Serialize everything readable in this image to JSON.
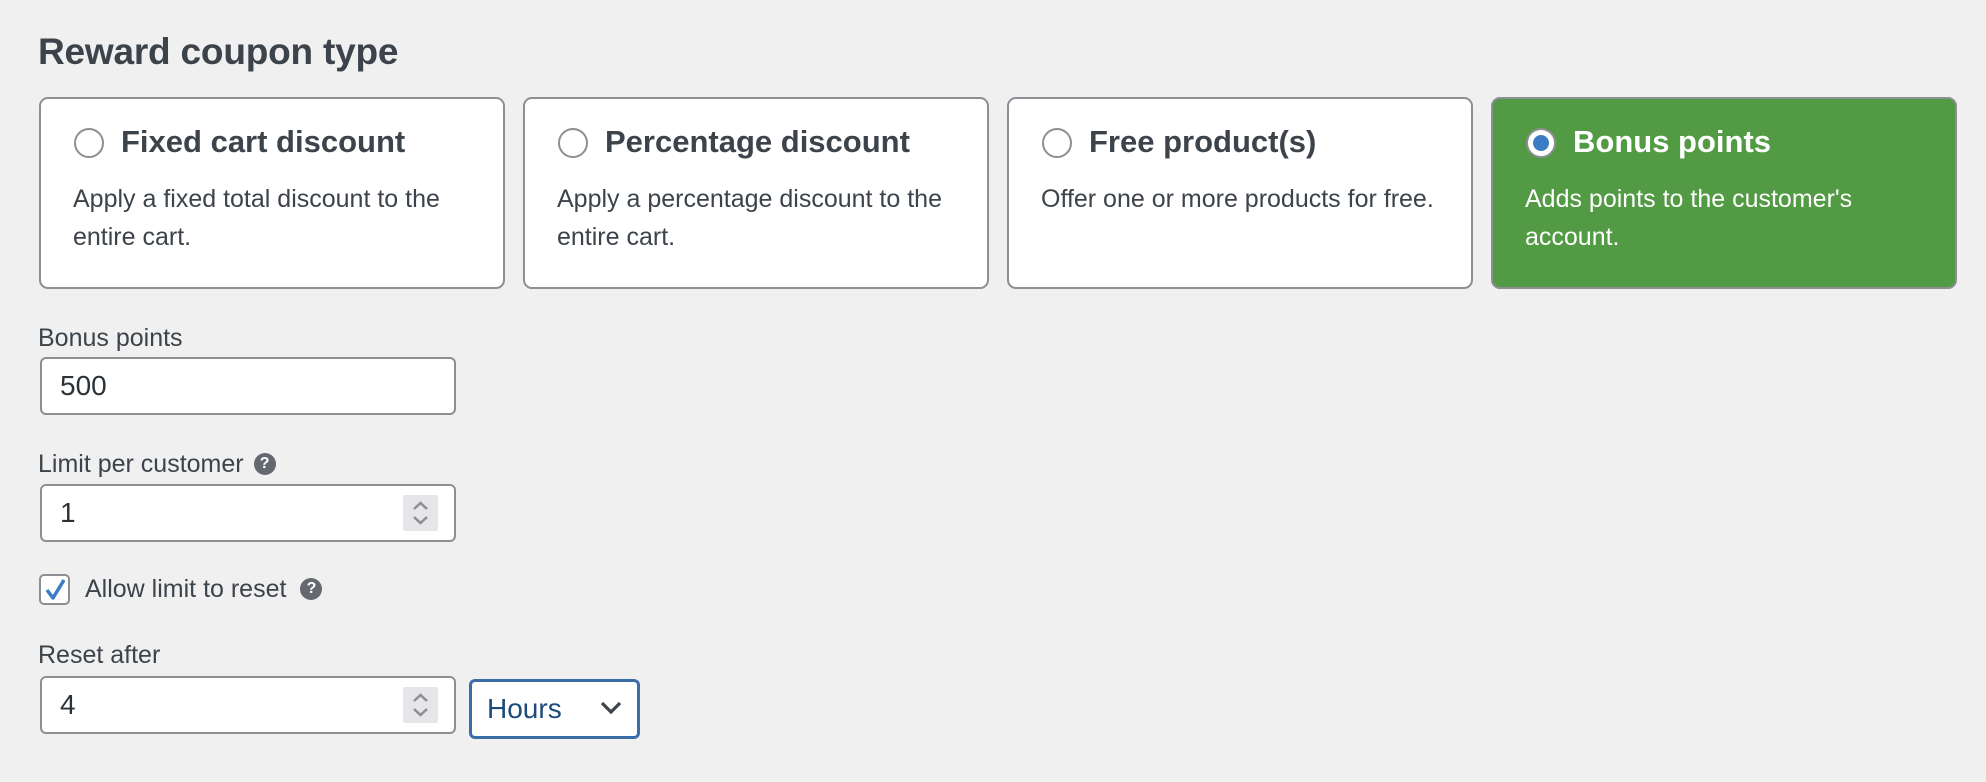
{
  "section": {
    "title": "Reward coupon type"
  },
  "coupon_types": [
    {
      "label": "Fixed cart discount",
      "description": "Apply a fixed total discount to the entire cart.",
      "selected": false
    },
    {
      "label": "Percentage discount",
      "description": "Apply a percentage discount to the entire cart.",
      "selected": false
    },
    {
      "label": "Free product(s)",
      "description": "Offer one or more products for free.",
      "selected": false
    },
    {
      "label": "Bonus points",
      "description": "Adds points to the customer's account.",
      "selected": true
    }
  ],
  "colors": {
    "selected_card": "#529a43",
    "radio_dot": "#3b7cc4",
    "focus_border": "#3b6ea8"
  },
  "fields": {
    "bonus_points": {
      "label": "Bonus points",
      "value": "500"
    },
    "limit_per_customer": {
      "label": "Limit per customer",
      "value": "1",
      "help_icon": "?"
    },
    "allow_limit_reset": {
      "label": "Allow limit to reset",
      "checked": true,
      "help_icon": "?"
    },
    "reset_after": {
      "label": "Reset after",
      "value": "4",
      "unit": "Hours"
    }
  }
}
